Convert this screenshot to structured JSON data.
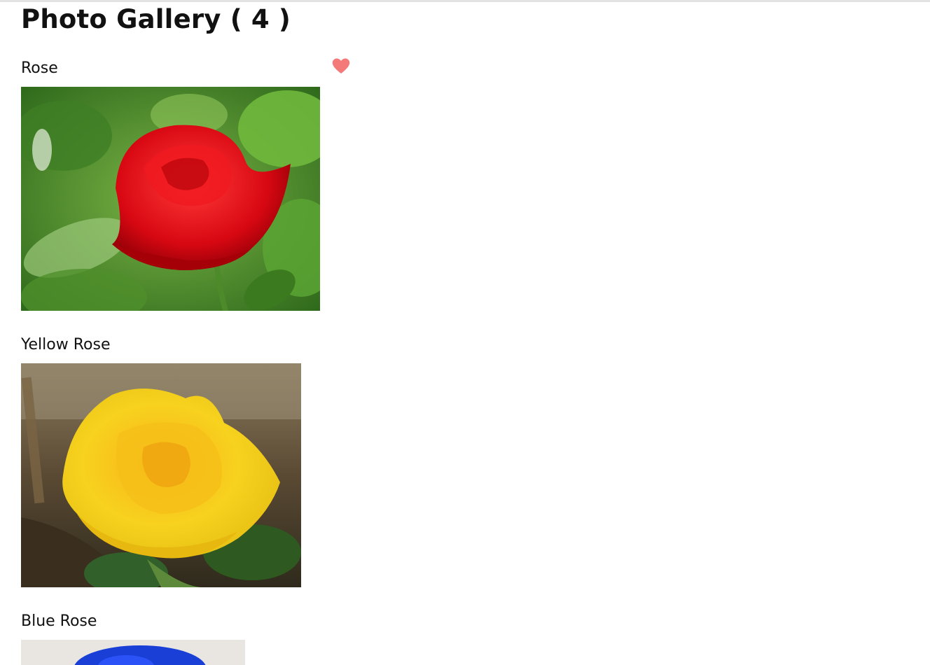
{
  "gallery": {
    "title": "Photo Gallery ( 4 )"
  },
  "photos": [
    {
      "title": "Rose",
      "favorite": true,
      "favorite_icon": "heart-icon",
      "favorite_color": "#f47a7a",
      "dominant_color": "#e0101a"
    },
    {
      "title": "Yellow Rose",
      "favorite": false,
      "dominant_color": "#f5cf1a"
    },
    {
      "title": "Blue Rose",
      "favorite": false,
      "dominant_color": "#1a3fd6"
    }
  ]
}
